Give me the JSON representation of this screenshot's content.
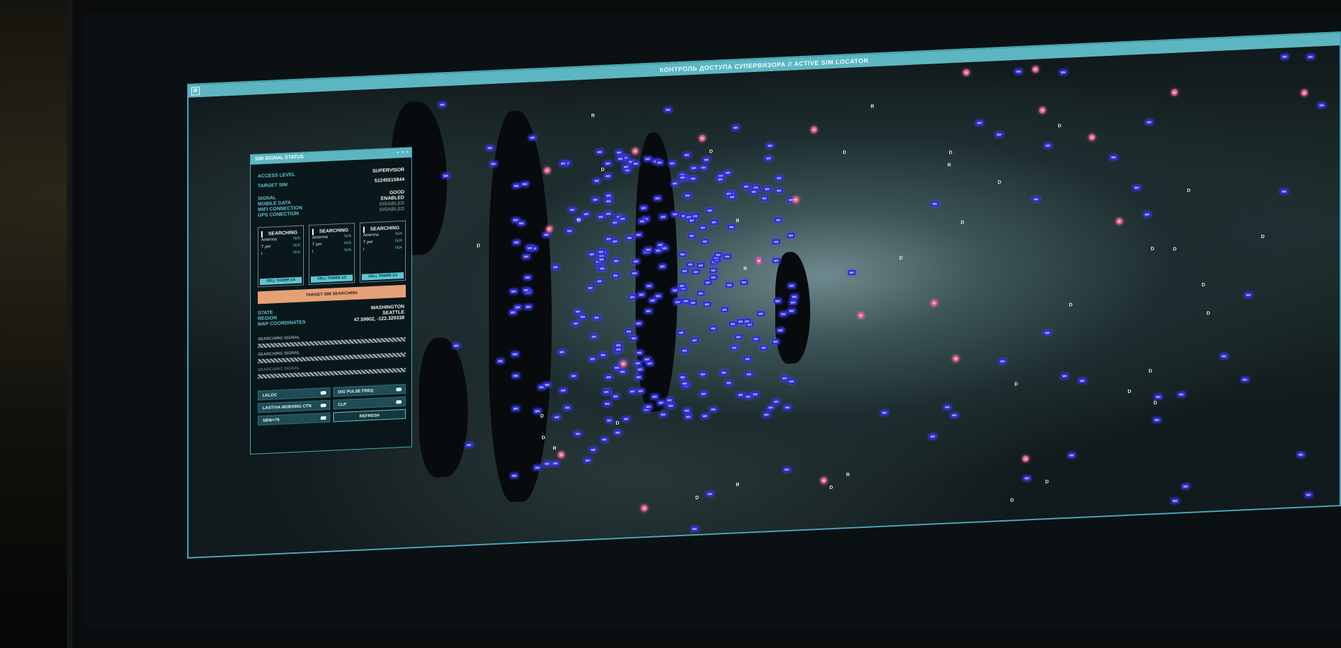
{
  "window": {
    "title": "КОНТРОЛЬ ДОСТУПА СУПЕРВИЗОРА // ACTIVE SIM LOCATOR"
  },
  "panel": {
    "title": "SIM SIGNAL STATUS",
    "controls": "▪ ▪ ▪",
    "access_level_label": "ACCESS LEVEL",
    "access_level_value": "SUPERVISOR",
    "target_sim_label": "TARGET SIM",
    "target_sim_value": "51245515844",
    "signal_label": "SIGNAL",
    "signal_value": "GOOD",
    "mobile_data_label": "MOBILE DATA",
    "mobile_data_value": "ENABLED",
    "wifi_label": "WIFI CONNECTION",
    "wifi_value": "DISABLED",
    "gps_label": "GPS CONECTION",
    "gps_value": "DISABLED",
    "towers": [
      {
        "status": "SEARCHING",
        "antenna": "Antenna",
        "antenna_val": "N/A",
        "tper": "T per",
        "tper_val": "N/A",
        "t": "t",
        "t_val": "N/A",
        "footer": "CELL TOWER 1/3"
      },
      {
        "status": "SEARCHING",
        "antenna": "Antenna",
        "antenna_val": "N/A",
        "tper": "T per",
        "tper_val": "N/A",
        "t": "t",
        "t_val": "N/A",
        "footer": "CELL TOWER 1/3"
      },
      {
        "status": "SEARCHING",
        "antenna": "Antenna",
        "antenna_val": "N/A",
        "tper": "T per",
        "tper_val": "N/A",
        "t": "t",
        "t_val": "N/A",
        "footer": "CELL TOWER 1/3"
      }
    ],
    "search_button": "TARGET SIM SEARCHING",
    "state_label": "STATE",
    "state_value": "WASHINGTON",
    "region_label": "REGION",
    "region_value": "SEATTLE",
    "coords_label": "MAP COORDINATES",
    "coords_value": "47.59902, -122.329338",
    "bars": [
      "SEARCHING SIGNAL",
      "SEARCHING SIGNAL",
      "SEARCHING SIGNAL"
    ],
    "toggles": {
      "lkloc": "LKLOC",
      "dig_pulse": "DIG PULSE FREQ",
      "lastvia": "LASTVIA MOBXING CTN",
      "clp": "CLP",
      "sbw": "SBW>75",
      "refresh": "REFRESH"
    }
  },
  "map": {
    "marker_labels": {
      "wx": "WX",
      "w": "W",
      "d": "D",
      "r": "R"
    },
    "colors": {
      "wx": "#2b2bd6",
      "w": "#e0628a",
      "frame": "#5cb6c2",
      "accent": "#e4a178"
    }
  }
}
